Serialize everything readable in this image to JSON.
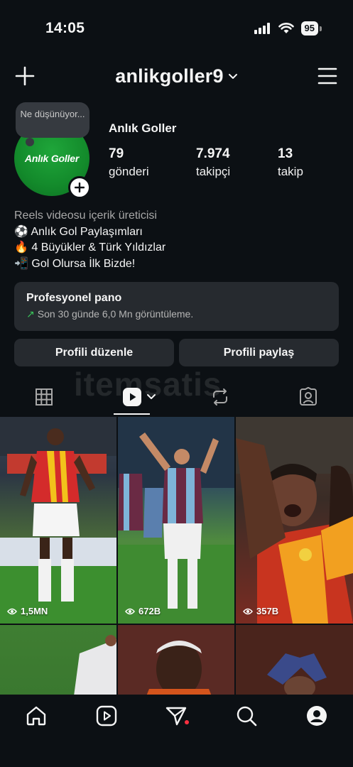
{
  "status_bar": {
    "time": "14:05",
    "battery": "95"
  },
  "header": {
    "username": "anlikgoller9"
  },
  "profile": {
    "note": "Ne düşünüyor...",
    "avatar_text": "Anlık Goller",
    "display_name": "Anlık Goller",
    "stats": [
      {
        "value": "79",
        "label": "gönderi"
      },
      {
        "value": "7.974",
        "label": "takipçi"
      },
      {
        "value": "13",
        "label": "takip"
      }
    ],
    "bio": {
      "category": "Reels videosu içerik üreticisi",
      "lines": [
        "⚽ Anlık Gol Paylaşımları",
        "🔥 4 Büyükler & Türk Yıldızlar",
        "📲 Gol Olursa İlk Bizde!"
      ]
    }
  },
  "dashboard": {
    "title": "Profesyonel pano",
    "subtitle": "Son 30 günde 6,0 Mn görüntüleme."
  },
  "buttons": {
    "edit": "Profili düzenle",
    "share": "Profili paylaş"
  },
  "watermark": "itemsatis",
  "grid": {
    "items": [
      {
        "views": "1,5MN"
      },
      {
        "views": "672B"
      },
      {
        "views": "357B"
      },
      {
        "views": ""
      },
      {
        "views": ""
      },
      {
        "views": ""
      }
    ]
  },
  "colors": {
    "background": "#0c1014",
    "card": "#262a2f",
    "accent_green": "#3ac45a",
    "notification_dot": "#ff3040"
  },
  "icons": {
    "top_bar": [
      "plus-icon",
      "chevron-down-icon",
      "menu-icon"
    ],
    "tabs": [
      "grid-icon",
      "reels-icon",
      "repost-icon",
      "tagged-icon"
    ],
    "nav": [
      "home-icon",
      "reels-icon",
      "send-icon",
      "search-icon",
      "profile-icon"
    ]
  }
}
